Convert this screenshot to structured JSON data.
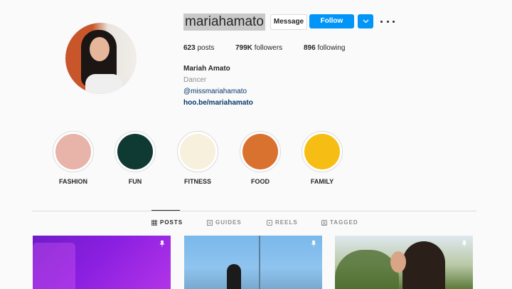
{
  "profile": {
    "username": "mariahamato",
    "message_label": "Message",
    "follow_label": "Follow",
    "stats": {
      "posts_value": "623",
      "posts_label": "posts",
      "followers_value": "799K",
      "followers_label": "followers",
      "following_value": "896",
      "following_label": "following"
    },
    "full_name": "Mariah Amato",
    "category": "Dancer",
    "mention": "@missmariahamato",
    "website": "hoo.be/mariahamato"
  },
  "highlights": [
    {
      "label": "FASHION",
      "color": "#e8b3a8"
    },
    {
      "label": "FUN",
      "color": "#0f3a33"
    },
    {
      "label": "FITNESS",
      "color": "#f6f0dd"
    },
    {
      "label": "FOOD",
      "color": "#d9722f"
    },
    {
      "label": "FAMILY",
      "color": "#f6be14"
    }
  ],
  "tabs": [
    {
      "label": "POSTS",
      "icon": "grid-icon",
      "active": true
    },
    {
      "label": "GUIDES",
      "icon": "guides-icon",
      "active": false
    },
    {
      "label": "REELS",
      "icon": "reels-icon",
      "active": false
    },
    {
      "label": "TAGGED",
      "icon": "tagged-icon",
      "active": false
    }
  ],
  "colors": {
    "accent": "#0095f6",
    "link": "#00376b",
    "muted": "#8e8e8e"
  }
}
